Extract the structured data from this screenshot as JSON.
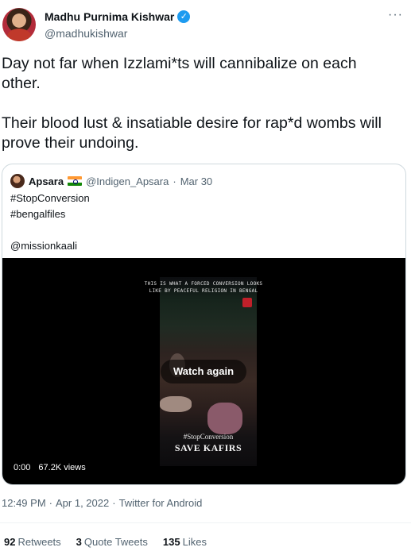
{
  "author": {
    "name": "Madhu Purnima Kishwar",
    "handle": "@madhukishwar",
    "verified_icon": "verified-badge-icon"
  },
  "tweet": {
    "text": "Day not far when Izzlami*ts will cannibalize on each other.\n\nTheir blood lust & insatiable desire for rap*d wombs will prove their undoing.",
    "more_icon": "···"
  },
  "quote": {
    "name": "Apsara",
    "flag_icon": "india-flag-icon",
    "handle": "@Indigen_Apsara",
    "separator": "·",
    "date": "Mar 30",
    "lines": [
      "#StopConversion",
      "#bengalfiles",
      "",
      "@missionkaali"
    ]
  },
  "video": {
    "caption": "THIS IS WHAT A FORCED CONVERSION LOOKS\nLIKE BY PEACEFUL RELIGION IN BENGAL",
    "hashtag": "#StopConversion",
    "title": "SAVE KAFIRS",
    "watch_label": "Watch again",
    "time": "0:00",
    "views": "67.2K views"
  },
  "footer": {
    "time": "12:49 PM",
    "date": "Apr 1, 2022",
    "client": "Twitter for Android",
    "separator": "·"
  },
  "stats": {
    "retweets_count": "92",
    "retweets_label": "Retweets",
    "quotes_count": "3",
    "quotes_label": "Quote Tweets",
    "likes_count": "135",
    "likes_label": "Likes"
  },
  "colors": {
    "text": "#0f1419",
    "secondary": "#536471",
    "accent": "#1d9bf0",
    "border": "#cfd9de"
  }
}
